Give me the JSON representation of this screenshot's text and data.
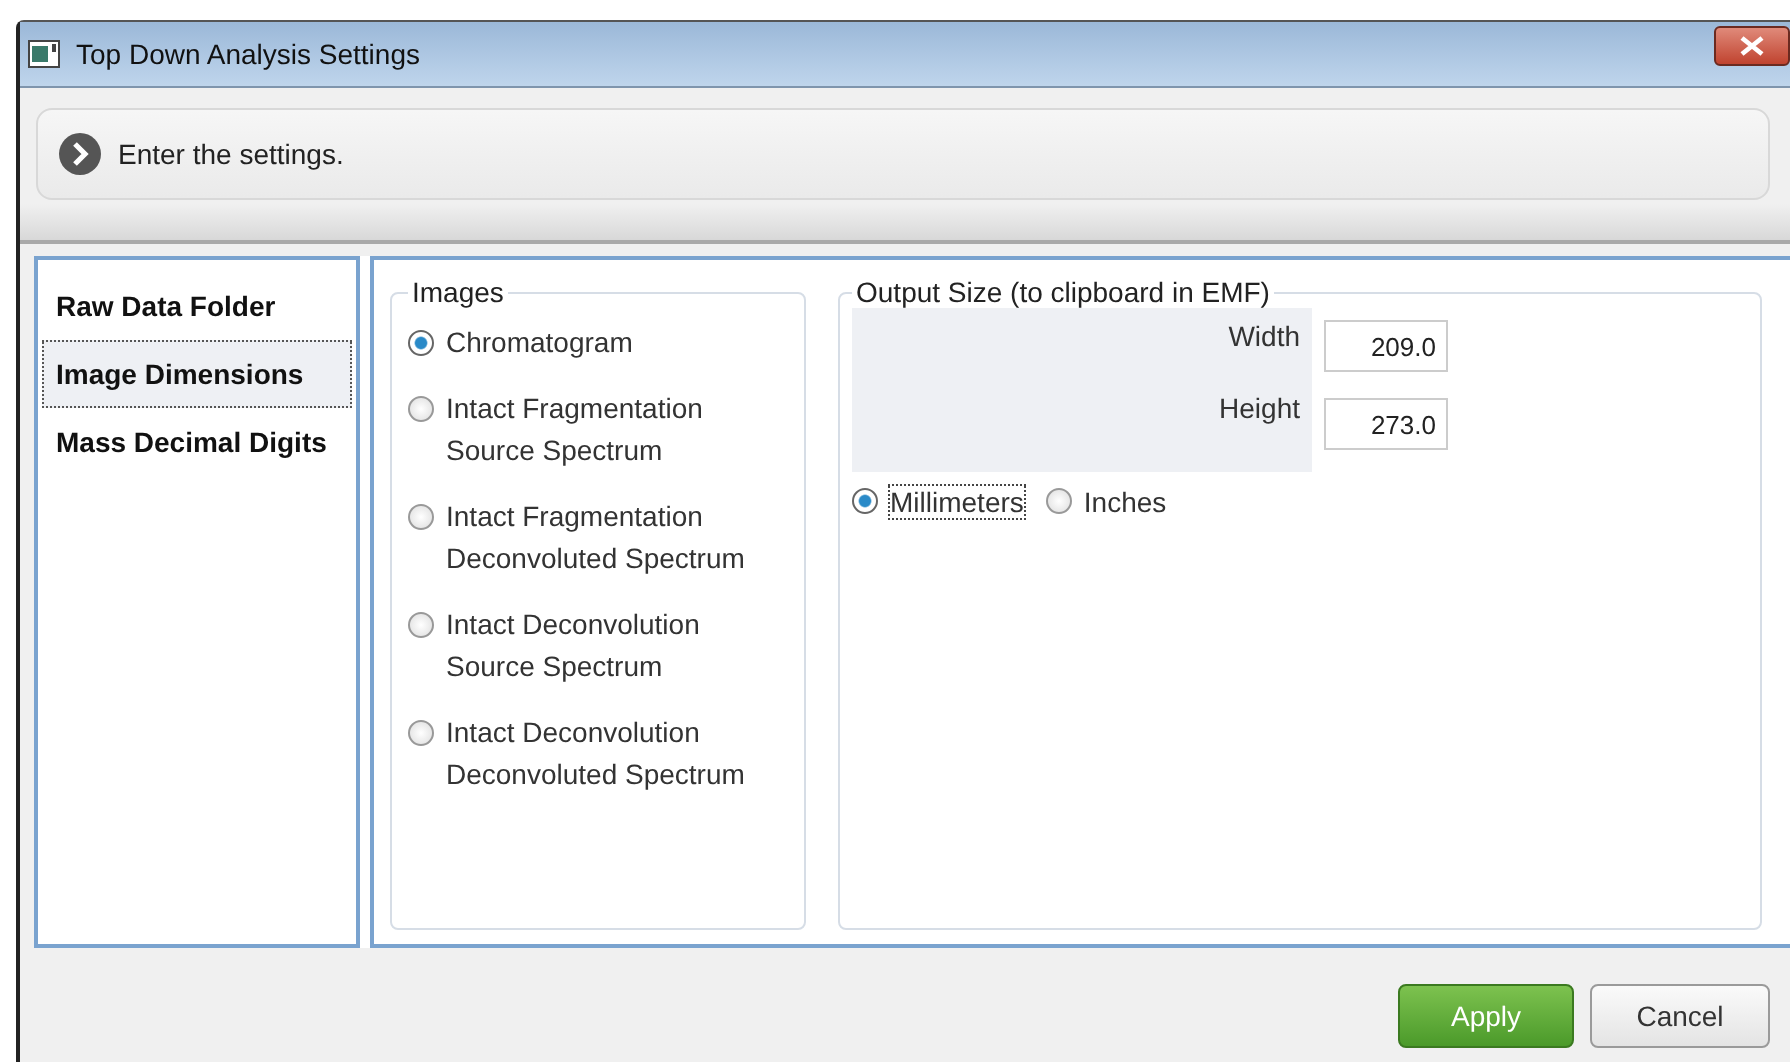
{
  "window": {
    "title": "Top Down Analysis Settings"
  },
  "instruction": "Enter the settings.",
  "sidebar": {
    "items": [
      {
        "label": "Raw Data Folder",
        "selected": false
      },
      {
        "label": "Image Dimensions",
        "selected": true
      },
      {
        "label": "Mass Decimal Digits",
        "selected": false
      }
    ]
  },
  "images": {
    "legend": "Images",
    "options": [
      {
        "label": "Chromatogram",
        "selected": true
      },
      {
        "label": "Intact Fragmentation Source Spectrum",
        "selected": false
      },
      {
        "label": "Intact Fragmentation Deconvoluted Spectrum",
        "selected": false
      },
      {
        "label": "Intact Deconvolution Source Spectrum",
        "selected": false
      },
      {
        "label": "Intact Deconvolution Deconvoluted Spectrum",
        "selected": false
      }
    ]
  },
  "output_size": {
    "legend": "Output Size (to clipboard in EMF)",
    "fields": [
      {
        "label": "Width",
        "value": "209.0"
      },
      {
        "label": "Height",
        "value": "273.0"
      }
    ],
    "units": [
      {
        "label": "Millimeters",
        "selected": true
      },
      {
        "label": "Inches",
        "selected": false
      }
    ]
  },
  "buttons": [
    {
      "label": "Apply",
      "kind": "primary"
    },
    {
      "label": "Cancel",
      "kind": "secondary"
    }
  ]
}
